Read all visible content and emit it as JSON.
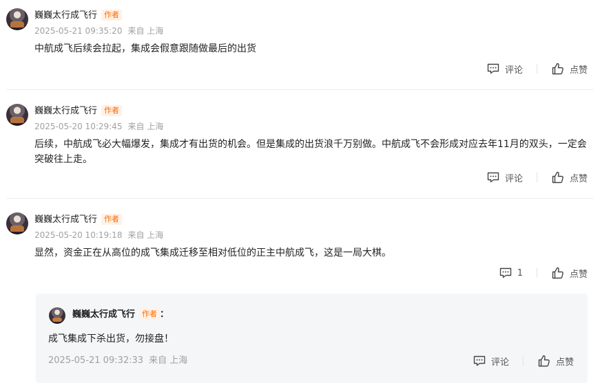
{
  "posts": [
    {
      "author": "巍巍太行成飞行",
      "badge": "作者",
      "time": "2025-05-21 09:35:20",
      "location": "来自 上海",
      "content": "中航成飞后续会拉起，集成会假意跟随做最后的出货",
      "comment_label": "评论",
      "like_label": "点赞"
    },
    {
      "author": "巍巍太行成飞行",
      "badge": "作者",
      "time": "2025-05-20 10:29:45",
      "location": "来自 上海",
      "content": "后续，中航成飞必大幅爆发，集成才有出货的机会。但是集成的出货浪千万别做。中航成飞不会形成对应去年11月的双头，一定会突破往上走。",
      "comment_label": "评论",
      "like_label": "点赞"
    },
    {
      "author": "巍巍太行成飞行",
      "badge": "作者",
      "time": "2025-05-20 10:19:18",
      "location": "来自 上海",
      "content": "显然，资金正在从高位的成飞集成迁移至相对低位的正主中航成飞，这是一局大棋。",
      "comment_label": "1",
      "like_label": "点赞"
    }
  ],
  "reply": {
    "author": "巍巍太行成飞行",
    "badge": "作者",
    "colon": "：",
    "content": "成飞集成下杀出货，勿接盘！",
    "time": "2025-05-21 09:32:33",
    "location": "来自 上海",
    "comment_label": "评论",
    "like_label": "点赞"
  },
  "colors": {
    "badge_text": "#ff6a00",
    "badge_bg": "#fff1e6",
    "meta": "#a0a0a0",
    "reply_bg": "#f5f6f8"
  },
  "icons": {
    "comment": "comment-icon",
    "like": "thumbs-up-icon"
  }
}
